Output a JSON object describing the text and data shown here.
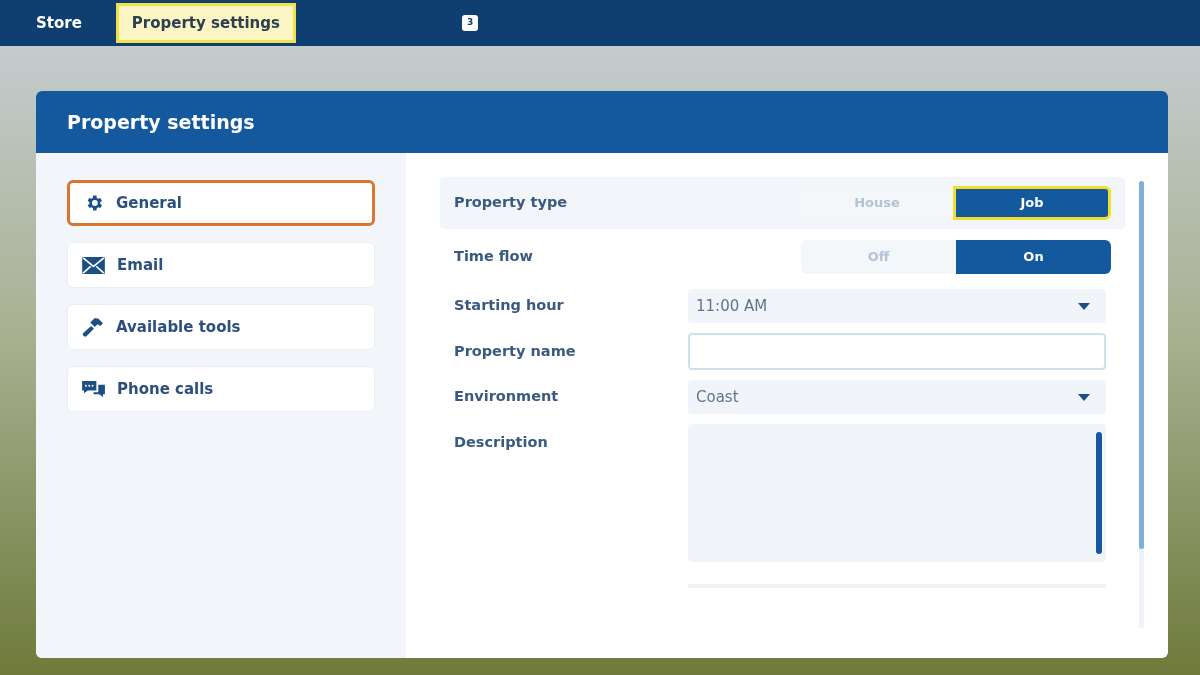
{
  "top_bar": {
    "tabs": [
      {
        "label": "Store",
        "selected": false
      },
      {
        "label": "Property settings",
        "selected": true
      }
    ],
    "badge": "3"
  },
  "panel": {
    "title": "Property settings"
  },
  "sidebar": {
    "items": [
      {
        "label": "General",
        "selected": true
      },
      {
        "label": "Email",
        "selected": false
      },
      {
        "label": "Available tools",
        "selected": false
      },
      {
        "label": "Phone calls",
        "selected": false
      }
    ]
  },
  "settings": [
    {
      "kind": "segmented",
      "label": "Property type",
      "focused": true,
      "options": [
        {
          "label": "House",
          "selected": false
        },
        {
          "label": "Job",
          "selected": true
        }
      ]
    },
    {
      "kind": "segmented",
      "label": "Time flow",
      "focused": false,
      "options": [
        {
          "label": "Off",
          "selected": false
        },
        {
          "label": "On",
          "selected": true
        }
      ]
    },
    {
      "kind": "select",
      "label": "Starting hour",
      "value": "11:00 AM"
    },
    {
      "kind": "text",
      "label": "Property name"
    },
    {
      "kind": "select",
      "label": "Environment",
      "value": "Coast"
    },
    {
      "kind": "textarea",
      "label": "Description"
    }
  ]
}
